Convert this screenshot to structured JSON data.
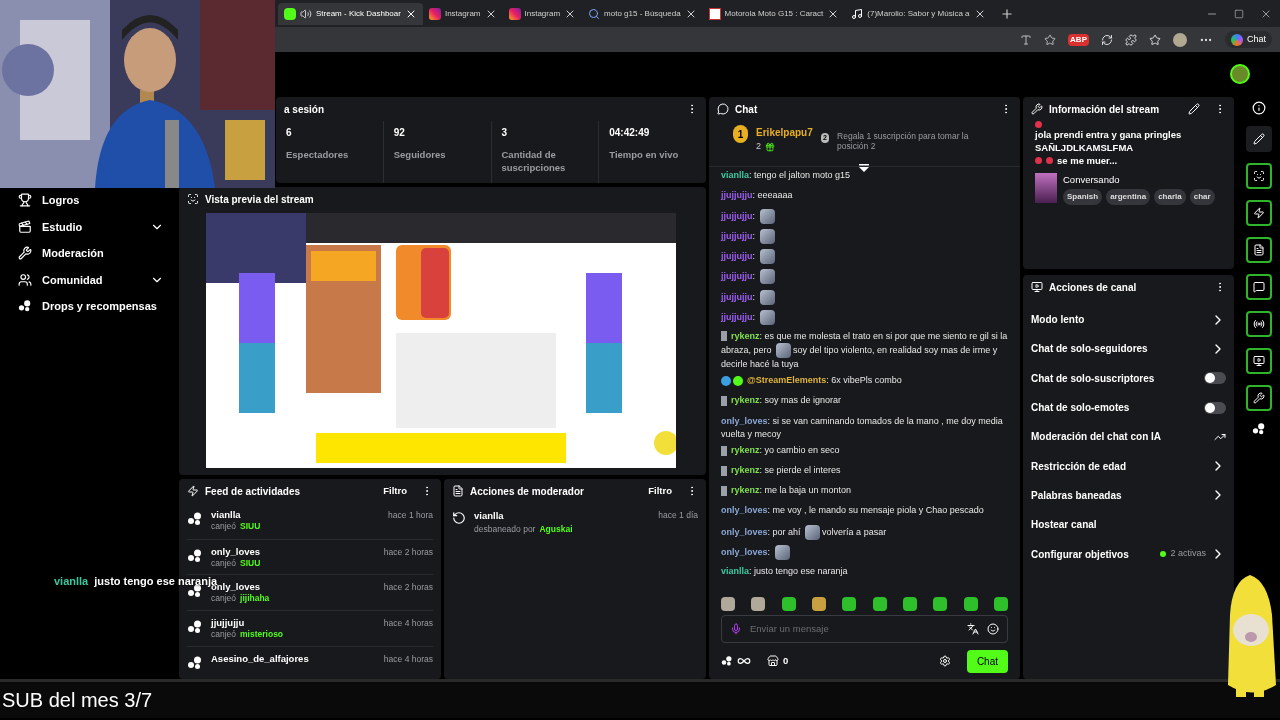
{
  "browser": {
    "tabs": [
      {
        "label": "Stream - Kick Dashboar",
        "kind": "kick",
        "selected": true
      },
      {
        "label": "Instagram",
        "kind": "instagram",
        "selected": false
      },
      {
        "label": "Instagram",
        "kind": "instagram",
        "selected": false
      },
      {
        "label": "moto g15 - Búsqueda",
        "kind": "search",
        "selected": false
      },
      {
        "label": "Motorola Moto G15 : Caract",
        "kind": "site",
        "selected": false
      },
      {
        "label": "(7)Marolio: Sabor y Música a",
        "kind": "tiktok",
        "selected": false
      }
    ],
    "adblock": "ABP",
    "copilot": "Chat"
  },
  "sidebar": {
    "items": [
      {
        "label": "Logros",
        "kind": "trophy",
        "expandable": false
      },
      {
        "label": "Estudio",
        "kind": "studio",
        "expandable": true
      },
      {
        "label": "Moderación",
        "kind": "wrench",
        "expandable": false
      },
      {
        "label": "Comunidad",
        "kind": "users",
        "expandable": true
      },
      {
        "label": "Drops y recompensas",
        "kind": "drops",
        "expandable": false
      }
    ]
  },
  "session": {
    "title": "a sesión",
    "stats": [
      {
        "value": "6",
        "label": "Espectadores"
      },
      {
        "value": "92",
        "label": "Seguidores"
      },
      {
        "value": "3",
        "label": "Cantidad de suscripciones"
      },
      {
        "value": "04:42:49",
        "label": "Tiempo en vivo"
      }
    ]
  },
  "preview": {
    "title": "Vista previa del stream"
  },
  "feed": {
    "title": "Feed de actividades",
    "filter": "Filtro",
    "items": [
      {
        "user": "vianlla",
        "action": "canjeó",
        "reward": "SIUU",
        "time": "hace 1 hora"
      },
      {
        "user": "only_loves",
        "action": "canjeó",
        "reward": "SIUU",
        "time": "hace 2 horas"
      },
      {
        "user": "only_loves",
        "action": "canjeó",
        "reward": "jijihaha",
        "time": "hace 2 horas"
      },
      {
        "user": "jjujjujju",
        "action": "canjeó",
        "reward": "misterioso",
        "time": "hace 4 horas"
      },
      {
        "user": "Asesino_de_alfajores",
        "time": "hace 4 horas"
      }
    ]
  },
  "mod_actions": {
    "title": "Acciones de moderador",
    "filter": "Filtro",
    "items": [
      {
        "user": "vianlla",
        "action": "desbaneado por",
        "by": "Aguskai",
        "time": "hace 1 día"
      }
    ]
  },
  "chat": {
    "title": "Chat",
    "leader": {
      "rank": "1",
      "name": "Erikelpapu7",
      "count": "2",
      "next_rank": "2",
      "text": "Regala 1 suscripción para tomar la posición 2"
    },
    "messages": [
      {
        "kind": "plain",
        "user": "vianlla",
        "sep": ":",
        "color": "#3cc9a0",
        "parts": [
          {
            "kind": "text",
            "text": "tengo el jalton moto g15"
          }
        ]
      },
      {
        "kind": "plain",
        "user": "jjujjujju",
        "sep": ":",
        "color": "#9b5cf0",
        "parts": [
          {
            "kind": "text",
            "text": "eeeaaaa"
          }
        ]
      },
      {
        "kind": "plain",
        "user": "jjujjujju",
        "sep": ":",
        "color": "#9b5cf0",
        "parts": [
          {
            "kind": "emote"
          }
        ]
      },
      {
        "kind": "plain",
        "user": "jjujjujju",
        "sep": ":",
        "color": "#9b5cf0",
        "parts": [
          {
            "kind": "emote"
          }
        ]
      },
      {
        "kind": "plain",
        "user": "jjujjujju",
        "sep": ":",
        "color": "#9b5cf0",
        "parts": [
          {
            "kind": "emote"
          }
        ]
      },
      {
        "kind": "plain",
        "user": "jjujjujju",
        "sep": ":",
        "color": "#9b5cf0",
        "parts": [
          {
            "kind": "emote"
          }
        ]
      },
      {
        "kind": "plain",
        "user": "jjujjujju",
        "sep": ":",
        "color": "#9b5cf0",
        "parts": [
          {
            "kind": "emote"
          }
        ]
      },
      {
        "kind": "plain",
        "user": "jjujjujju",
        "sep": ":",
        "color": "#9b5cf0",
        "parts": [
          {
            "kind": "emote"
          }
        ]
      },
      {
        "kind": "mod",
        "user": "rykenz",
        "sep": ":",
        "color": "#7fe04c",
        "parts": [
          {
            "kind": "text",
            "text": "es que me molesta el trato en si por que me siento re gil si la abraza, pero"
          },
          {
            "kind": "emote"
          },
          {
            "kind": "text",
            "text": "soy del tipo violento, en realidad soy mas de irme y decirle hacé la tuya"
          }
        ]
      },
      {
        "kind": "bot",
        "user": "@StreamElements",
        "sep": ":",
        "color": "#e0b43a",
        "parts": [
          {
            "kind": "text",
            "text": "6x vibePls combo"
          }
        ]
      },
      {
        "kind": "mod",
        "user": "rykenz",
        "sep": ":",
        "color": "#7fe04c",
        "parts": [
          {
            "kind": "text",
            "text": "soy mas de ignorar"
          }
        ]
      },
      {
        "kind": "plain",
        "user": "only_loves",
        "sep": ":",
        "color": "#8aa6d6",
        "parts": [
          {
            "kind": "text",
            "text": "si se van caminando tomados de la mano , me doy media vuelta y mecoy"
          }
        ]
      },
      {
        "kind": "mod",
        "user": "rykenz",
        "sep": ":",
        "color": "#7fe04c",
        "parts": [
          {
            "kind": "text",
            "text": "yo cambio en seco"
          }
        ]
      },
      {
        "kind": "mod",
        "user": "rykenz",
        "sep": ":",
        "color": "#7fe04c",
        "parts": [
          {
            "kind": "text",
            "text": "se pierde el interes"
          }
        ]
      },
      {
        "kind": "mod",
        "user": "rykenz",
        "sep": ":",
        "color": "#7fe04c",
        "parts": [
          {
            "kind": "text",
            "text": "me la baja un monton"
          }
        ]
      },
      {
        "kind": "plain",
        "user": "only_loves",
        "sep": ":",
        "color": "#8aa6d6",
        "parts": [
          {
            "kind": "text",
            "text": "me voy , le mando su mensaje piola y Chao pescado"
          }
        ]
      },
      {
        "kind": "plain",
        "user": "only_loves",
        "sep": ":",
        "color": "#8aa6d6",
        "parts": [
          {
            "kind": "text",
            "text": "por ahí"
          },
          {
            "kind": "emote"
          },
          {
            "kind": "text",
            "text": "volvería a pasar"
          }
        ]
      },
      {
        "kind": "plain",
        "user": "only_loves",
        "sep": ":",
        "color": "#8aa6d6",
        "parts": [
          {
            "kind": "emote"
          }
        ]
      },
      {
        "kind": "plain",
        "user": "vianlla",
        "sep": ":",
        "color": "#3cc9a0",
        "parts": [
          {
            "kind": "text",
            "text": "justo tengo ese naranja"
          }
        ]
      }
    ],
    "input": {
      "placeholder": "Enviar un mensaje"
    },
    "points": "0",
    "send": "Chat"
  },
  "stream_info": {
    "title": "Información del stream",
    "stream_title": [
      {
        "kind": "pin"
      },
      {
        "kind": "text",
        "text": "jola prendi entra y gana pringles SAÑLJDLKAMSLFMA"
      },
      {
        "kind": "pin"
      },
      {
        "kind": "pin"
      },
      {
        "kind": "text",
        "text": "se me muer..."
      }
    ],
    "category": "Conversando",
    "tags": [
      "Spanish",
      "argentina",
      "charla",
      "char"
    ]
  },
  "channel_actions": {
    "title": "Acciones de canal",
    "items": [
      {
        "label": "Modo lento",
        "kind": "arrow"
      },
      {
        "label": "Chat de solo-seguidores",
        "kind": "arrow"
      },
      {
        "label": "Chat de solo-suscriptores",
        "kind": "toggle",
        "on": false
      },
      {
        "label": "Chat de solo-emotes",
        "kind": "toggle",
        "on": false
      },
      {
        "label": "Moderación del chat con IA",
        "kind": "external"
      },
      {
        "label": "Restricción de edad",
        "kind": "arrow"
      },
      {
        "label": "Palabras baneadas",
        "kind": "arrow"
      },
      {
        "label": "Hostear canal",
        "kind": "plain"
      },
      {
        "label": "Configurar objetivos",
        "kind": "goal",
        "status": "2 activas"
      }
    ]
  },
  "overlay": {
    "user": "vianlla",
    "message": "justo tengo ese naranja",
    "caption": "SUB del mes 3/7"
  }
}
